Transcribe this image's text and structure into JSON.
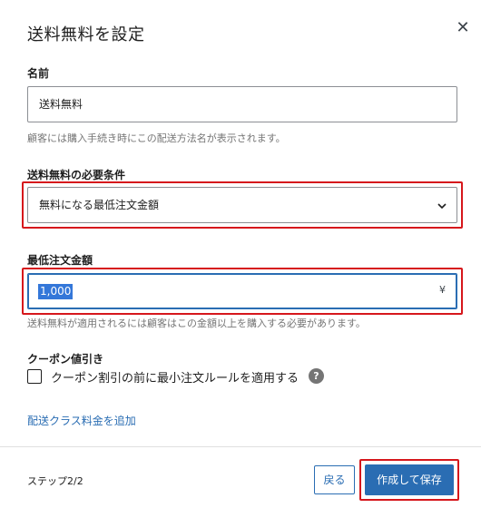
{
  "dialog": {
    "title": "送料無料を設定",
    "close_icon": "close-icon"
  },
  "name_field": {
    "label": "名前",
    "value": "送料無料",
    "help": "顧客には購入手続き時にこの配送方法名が表示されます。"
  },
  "requirement": {
    "label": "送料無料の必要条件",
    "selected": "無料になる最低注文金額",
    "icon": "chevron-down-icon"
  },
  "min_amount": {
    "label": "最低注文金額",
    "value": "1,000",
    "currency": "¥",
    "help": "送料無料が適用されるには顧客はこの金額以上を購入する必要があります。"
  },
  "coupon": {
    "label": "クーポン値引き",
    "checkbox_label": "クーポン割引の前に最小注文ルールを適用する",
    "checked": false,
    "help_icon": "?"
  },
  "add_class_link": "配送クラス料金を追加",
  "footer": {
    "step": "ステップ2/2",
    "back_label": "戻る",
    "save_label": "作成して保存"
  },
  "colors": {
    "accent": "#2a6db3",
    "highlight_border": "#d6171c",
    "selection": "#3477d9"
  }
}
